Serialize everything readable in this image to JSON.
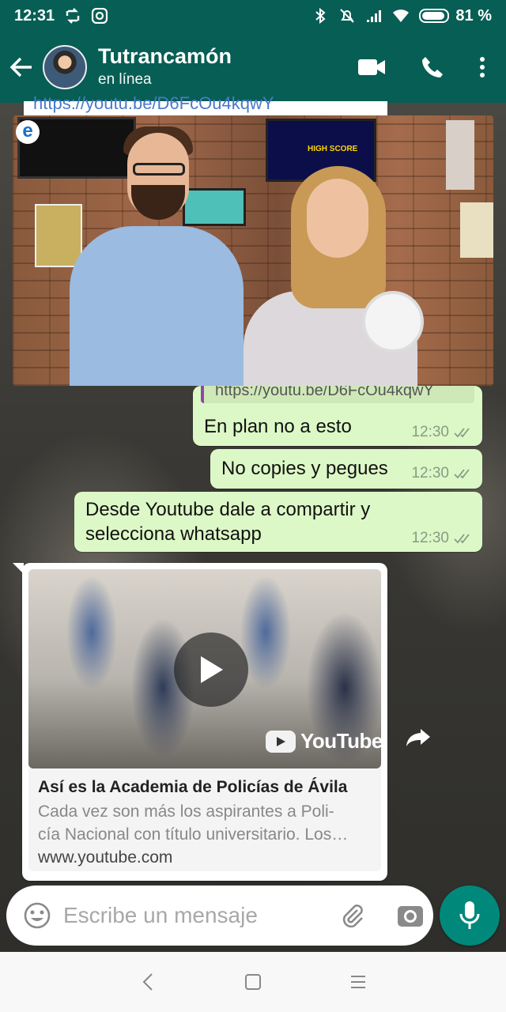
{
  "status_bar": {
    "time": "12:31",
    "battery": "81 %",
    "left_icons": [
      "sync-icon",
      "instagram-icon"
    ],
    "right_icons": [
      "bluetooth-icon",
      "mute-icon",
      "signal-icon",
      "wifi-icon",
      "battery-icon"
    ]
  },
  "header": {
    "contact_name": "Tutrancamón",
    "contact_status": "en línea",
    "actions": [
      "video-call-icon",
      "phone-icon",
      "more-icon"
    ]
  },
  "messages": [
    {
      "text": "https://youtu.be/D6FcOu4kqwY",
      "type": "partial-link"
    },
    {
      "quote": "https://youtu.be/D6FcOu4kqwY",
      "text": "En plan no a esto",
      "time": "12:30",
      "status": "read"
    },
    {
      "text": "No copies y pegues",
      "time": "12:30",
      "status": "read"
    },
    {
      "text_lines": [
        "Desde Youtube dale a compartir y",
        "selecciona whatsapp"
      ],
      "time": "12:30",
      "status": "read"
    }
  ],
  "link_preview": {
    "provider": "YouTube",
    "title": "Así es la Academia de Policías de Ávila",
    "description_lines": [
      "Cada vez son más los aspirantes a Poli-",
      "cía Nacional con título universitario. Los…"
    ],
    "domain": "www.youtube.com"
  },
  "composer": {
    "placeholder": "Escribe un mensaje"
  },
  "video_overlay": {
    "tv_text": "HIGH SCORE",
    "logo": "e"
  },
  "colors": {
    "header": "#075e54",
    "outgoing_bubble": "#dcf8c6",
    "mic_button": "#00897b",
    "read_ticks": "#8a9a86"
  }
}
